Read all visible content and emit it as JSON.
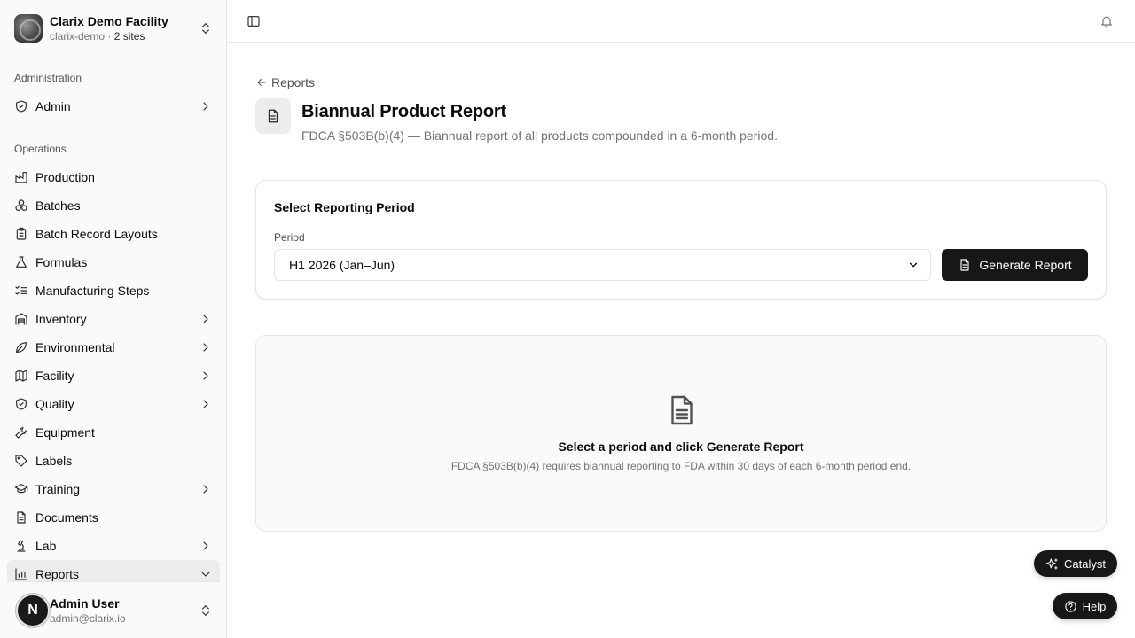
{
  "org": {
    "name": "Clarix Demo Facility",
    "slug": "clarix-demo",
    "separator": "·",
    "sites": "2 sites"
  },
  "sidebar": {
    "groups": [
      {
        "label": "Administration"
      },
      {
        "label": "Operations"
      }
    ],
    "items": [
      {
        "label": "Admin",
        "icon": "shield-check-icon",
        "chevron": "right"
      },
      {
        "label": "Production",
        "icon": "factory-icon"
      },
      {
        "label": "Batches",
        "icon": "boxes-icon"
      },
      {
        "label": "Batch Record Layouts",
        "icon": "clipboard-list-icon"
      },
      {
        "label": "Formulas",
        "icon": "flask-icon"
      },
      {
        "label": "Manufacturing Steps",
        "icon": "list-checks-icon"
      },
      {
        "label": "Inventory",
        "icon": "warehouse-icon",
        "chevron": "right"
      },
      {
        "label": "Environmental",
        "icon": "leaf-icon",
        "chevron": "right"
      },
      {
        "label": "Facility",
        "icon": "map-icon",
        "chevron": "right"
      },
      {
        "label": "Quality",
        "icon": "shield-icon",
        "chevron": "right"
      },
      {
        "label": "Equipment",
        "icon": "wrench-icon"
      },
      {
        "label": "Labels",
        "icon": "tag-icon"
      },
      {
        "label": "Training",
        "icon": "graduation-cap-icon",
        "chevron": "right"
      },
      {
        "label": "Documents",
        "icon": "file-text-icon"
      },
      {
        "label": "Lab",
        "icon": "microscope-icon",
        "chevron": "right"
      },
      {
        "label": "Reports",
        "icon": "bar-chart-icon",
        "chevron": "down",
        "active": true
      }
    ]
  },
  "user": {
    "initial": "N",
    "name": "Admin User",
    "email": "admin@clarix.io"
  },
  "page": {
    "back_label": "Reports",
    "title": "Biannual Product Report",
    "description": "FDCA §503B(b)(4) — Biannual report of all products compounded in a 6-month period."
  },
  "period_card": {
    "title": "Select Reporting Period",
    "field_label": "Period",
    "selected": "H1 2026 (Jan–Jun)",
    "button_label": "Generate Report"
  },
  "empty_state": {
    "title": "Select a period and click Generate Report",
    "subtitle": "FDCA §503B(b)(4) requires biannual reporting to FDA within 30 days of each 6-month period end."
  },
  "floating": {
    "catalyst_label": "Catalyst",
    "help_label": "Help"
  }
}
